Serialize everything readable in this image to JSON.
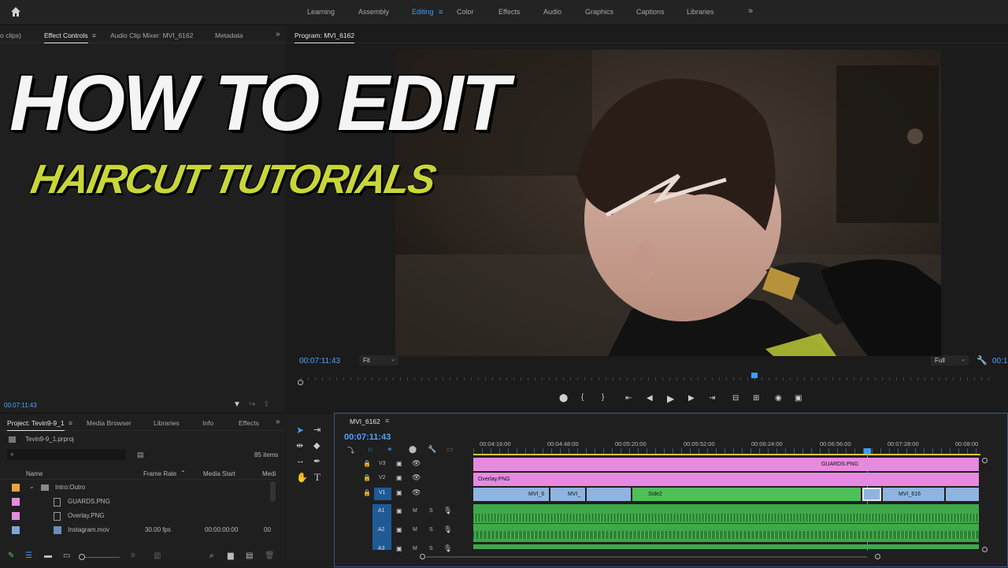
{
  "topbar": {
    "home_icon": "home-icon",
    "workspaces": [
      "Learning",
      "Assembly",
      "Editing",
      "Color",
      "Effects",
      "Audio",
      "Graphics",
      "Captions",
      "Libraries"
    ],
    "active_workspace": "Editing",
    "overflow": "»"
  },
  "source_panel": {
    "tabs": [
      "o clips)",
      "Effect Controls",
      "Audio Clip Mixer: MVI_6162",
      "Metadata"
    ],
    "active_tab": "Effect Controls",
    "overflow": "»",
    "timecode": "00:07:11:43"
  },
  "overlay_text": {
    "headline": "HOW TO EDIT",
    "subline": "HAIRCUT TUTORIALS"
  },
  "program": {
    "title": "Program: MVI_6162",
    "timecode": "00:07:11:43",
    "fit_label": "Fit",
    "quality_label": "Full",
    "right_timecode": "00:1"
  },
  "project": {
    "tabs": [
      "Project: Tevin9-9_1",
      "Media Browser",
      "Libraries",
      "Info",
      "Effects"
    ],
    "file": "Tevin9-9_1.prproj",
    "item_count": "85 items",
    "columns": [
      "Name",
      "Frame Rate",
      "Media Start",
      "Medi"
    ],
    "rows": [
      {
        "name": "Intro:Outro",
        "color": "#e8a33a",
        "frame_rate": "",
        "media_start": "",
        "extra": ""
      },
      {
        "name": "GUARDS.PNG",
        "color": "#e48ce0",
        "frame_rate": "",
        "media_start": "",
        "extra": ""
      },
      {
        "name": "Overlay.PNG",
        "color": "#e48ce0",
        "frame_rate": "",
        "media_start": "",
        "extra": ""
      },
      {
        "name": "Instagram.mov",
        "color": "#7aa7d8",
        "frame_rate": "30.00 fps",
        "media_start": "00:00:00:00",
        "extra": "00"
      }
    ]
  },
  "timeline": {
    "sequence": "MVI_6162",
    "timecode": "00:07:11:43",
    "ruler": [
      "00:04:16:00",
      "00:04:48:00",
      "00:05:20:00",
      "00:05:52:00",
      "00:06:24:00",
      "00:06:56:00",
      "00:07:28:00",
      "00:08:00"
    ],
    "tracks": [
      "V3",
      "V2",
      "V1",
      "A1",
      "A2",
      "A3"
    ],
    "clips": {
      "guards": "GUARDS.PNG",
      "overlay": "Overlay.PNG",
      "v1_a": "MVI_6",
      "v1_b": "MVI_",
      "side2": "Side2",
      "v1_c": "MVI_616"
    },
    "colors": {
      "pink": "#e58ae0",
      "green": "#4fbf5a",
      "blue": "#8fb4e0",
      "audio": "#3fa84a"
    }
  }
}
